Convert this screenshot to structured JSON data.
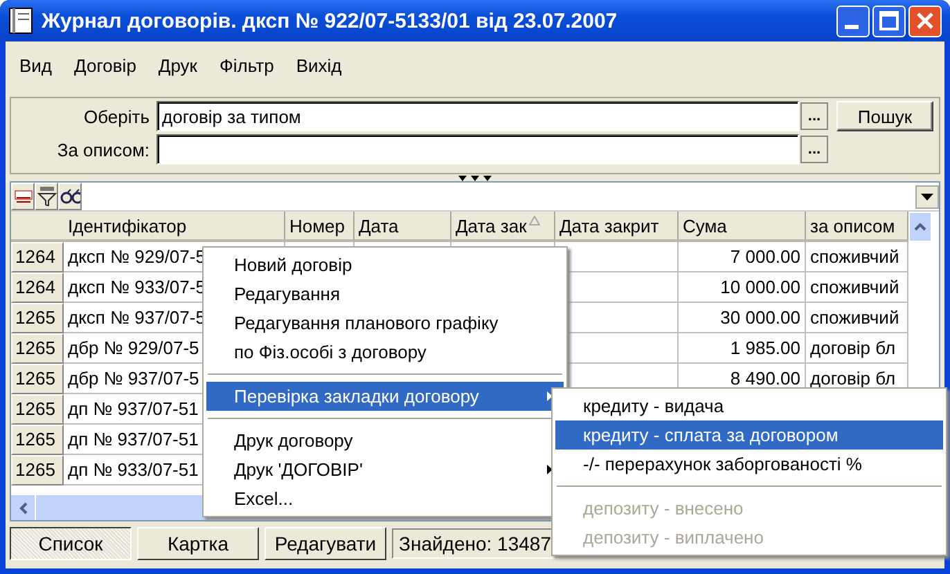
{
  "window": {
    "title": "Журнал договорів. дксп № 922/07-5133/01 від 23.07.2007"
  },
  "menu_bar": [
    "Вид",
    "Договір",
    "Друк",
    "Фільтр",
    "Вихід"
  ],
  "filter": {
    "fields": [
      {
        "label": "Оберіть",
        "value": "договір за типом",
        "browse": "..."
      },
      {
        "label": "За описом:",
        "browse": "..."
      }
    ],
    "search_button": "Пошук"
  },
  "grid": {
    "columns": [
      {
        "label": "Ідентифікатор",
        "sorted": false
      },
      {
        "label": "Номер",
        "sorted": false
      },
      {
        "label": "Дата",
        "sorted": false
      },
      {
        "label": "Дата зак",
        "sorted": true
      },
      {
        "label": "Дата закрит",
        "sorted": false
      },
      {
        "label": "Сума",
        "sorted": false
      },
      {
        "label": "за описом",
        "sorted": false
      }
    ],
    "rows": [
      {
        "id": "1264",
        "identifier": "дксп № 929/07-5",
        "sum": "7 000.00",
        "description": "споживчий"
      },
      {
        "id": "1264",
        "identifier": "дксп № 933/07-5",
        "sum": "10 000.00",
        "description": "споживчий"
      },
      {
        "id": "1265",
        "identifier": "дксп № 937/07-5",
        "sum": "30 000.00",
        "description": "споживчий"
      },
      {
        "id": "1265",
        "identifier": "дбр № 929/07-5",
        "sum": "1 985.00",
        "description": "договір бл"
      },
      {
        "id": "1265",
        "identifier": "дбр № 937/07-5",
        "sum": "8 490.00",
        "description": "договір бл"
      },
      {
        "id": "1265",
        "identifier": "дп № 937/07-51"
      },
      {
        "id": "1265",
        "identifier": "дп № 937/07-51"
      },
      {
        "id": "1265",
        "identifier": "дп № 933/07-51"
      }
    ]
  },
  "context_menu": {
    "items": [
      {
        "kind": "item",
        "label": "Новий договір",
        "selected": false
      },
      {
        "kind": "item",
        "label": "Редагування",
        "selected": false
      },
      {
        "kind": "item",
        "label": "Редагування планового графіку",
        "selected": false
      },
      {
        "kind": "item",
        "label": "по Фіз.особі з договору",
        "selected": false
      },
      {
        "kind": "separator"
      },
      {
        "kind": "item",
        "label": "Перевірка закладки договору",
        "selected": true,
        "submenu": true
      },
      {
        "kind": "separator"
      },
      {
        "kind": "item",
        "label": "Друк договору",
        "selected": false
      },
      {
        "kind": "item",
        "label": "Друк 'ДОГОВІР'",
        "selected": false,
        "submenu": true
      },
      {
        "kind": "item",
        "label": "Excel...",
        "selected": false
      }
    ]
  },
  "submenu": {
    "items": [
      {
        "kind": "item",
        "label": "кредиту - видача",
        "selected": false,
        "disabled": false
      },
      {
        "kind": "item",
        "label": "кредиту - сплата за договором",
        "selected": true,
        "disabled": false
      },
      {
        "kind": "item",
        "label": "-/- перерахунок заборгованості %",
        "selected": false,
        "disabled": false
      },
      {
        "kind": "separator"
      },
      {
        "kind": "item",
        "label": "депозиту - внесено",
        "selected": false,
        "disabled": true
      },
      {
        "kind": "item",
        "label": "депозиту - виплачено",
        "selected": false,
        "disabled": true
      }
    ]
  },
  "bottom_tabs": [
    {
      "label": "Список",
      "selected": true
    },
    {
      "label": "Картка",
      "selected": false
    },
    {
      "label": "Редагувати",
      "selected": false
    }
  ],
  "status": "Знайдено: 13487"
}
